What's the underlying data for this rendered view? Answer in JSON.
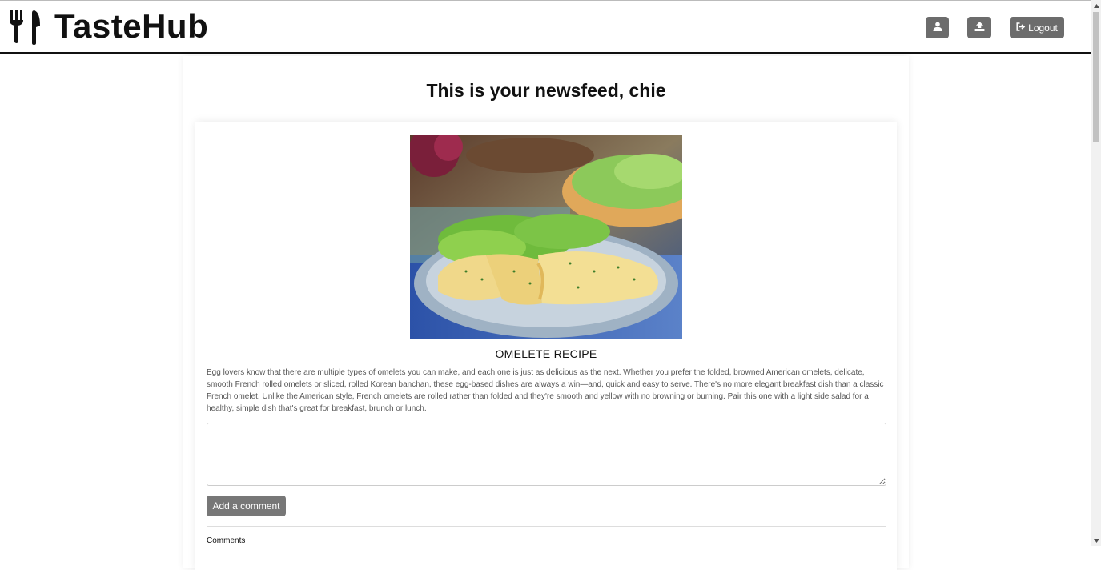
{
  "brand": {
    "name": "TasteHub",
    "icon": "fork-knife-icon"
  },
  "header": {
    "profile_icon": "user-icon",
    "upload_icon": "upload-icon",
    "logout_label": "Logout",
    "logout_icon": "sign-out-icon",
    "button_color": "#6c6c6c"
  },
  "feed": {
    "title": "This is your newsfeed, chie"
  },
  "post": {
    "title": "OMELETE RECIPE",
    "description": "Egg lovers know that there are multiple types of omelets you can make, and each one is just as delicious as the next. Whether you prefer the folded, browned American omelets, delicate, smooth French rolled omelets or sliced, rolled Korean banchan, these egg-based dishes are always a win—and, quick and easy to serve. There's no more elegant breakfast dish than a classic French omelet. Unlike the American style, French omelets are rolled rather than folded and they're smooth and yellow with no browning or burning. Pair this one with a light side salad for a healthy, simple dish that's great for breakfast, brunch or lunch.",
    "comment_placeholder": "",
    "add_comment_label": "Add a comment",
    "comments_label": "Comments"
  }
}
